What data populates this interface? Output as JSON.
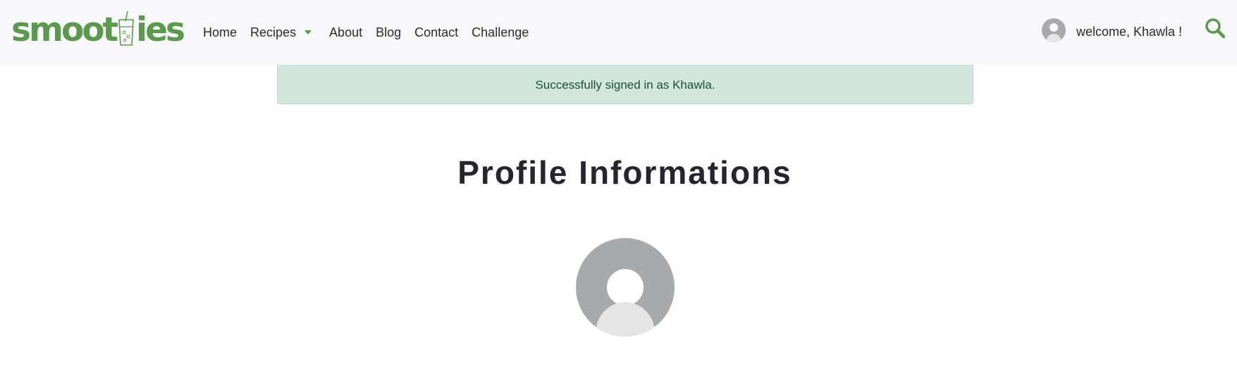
{
  "logo": {
    "text_left": "smoot",
    "text_right": "ies"
  },
  "nav": {
    "items": [
      {
        "label": "Home"
      },
      {
        "label": "Recipes"
      },
      {
        "label": "About"
      },
      {
        "label": "Blog"
      },
      {
        "label": "Contact"
      },
      {
        "label": "Challenge"
      }
    ]
  },
  "user": {
    "welcome": "welcome, Khawla !"
  },
  "alert": {
    "message": "Successfully signed in as Khawla."
  },
  "page": {
    "title": "Profile Informations"
  },
  "icons": {
    "dropdown": "caret-down-icon",
    "search": "search-icon",
    "avatar": "user-avatar-icon"
  },
  "colors": {
    "brand": "#5b9a4d",
    "navbar_bg": "#f8f8fa",
    "alert_bg": "#d1e7dd",
    "alert_text": "#1f4d36",
    "avatar_bg": "#a8a9ac"
  }
}
